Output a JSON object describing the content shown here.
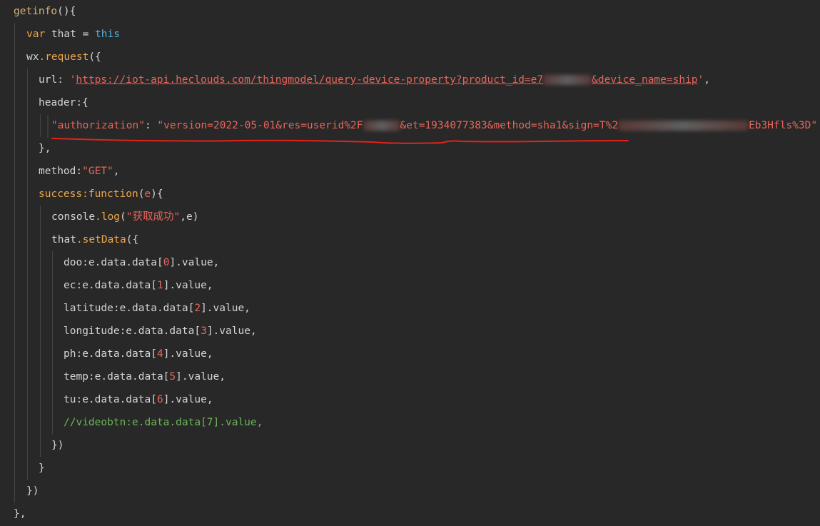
{
  "code": {
    "fn_name": "getinfo",
    "fn_open": "(){",
    "var_kw": "var",
    "that": "that",
    "eq": " = ",
    "this_kw": "this",
    "wx": "wx",
    "request": ".request",
    "request_open": "({",
    "url_key": "url: ",
    "quote": "'",
    "url_part1": "https://iot-api.heclouds.com/thingmodel/query-device-property?product_id=e7",
    "url_part2": "&device_name=ship",
    "url_end": ",",
    "header_key": "header:{",
    "auth_key": "\"authorization\"",
    "colon": ": ",
    "auth_part1": "\"version=2022-05-01&res=userid%2F",
    "auth_part2": "&et=1934077383&method=sha1&sign=T%2",
    "auth_part3": "Eb3Hfls%3D\"",
    "close_brace_comma": "},",
    "method_key": "method:",
    "method_val": "\"GET\"",
    "comma": ",",
    "success_key": "success:",
    "function_kw": "function",
    "success_args_open": "(",
    "success_arg": "e",
    "success_args_close": "){",
    "console": "console",
    "log": ".log",
    "paren_open": "(",
    "log_msg": "\"获取成功\"",
    "log_tail": ",e)",
    "set_data": ".setData",
    "set_data_open": "({",
    "fields": [
      {
        "key": "doo",
        "index": "0"
      },
      {
        "key": "ec",
        "index": "1"
      },
      {
        "key": "latitude",
        "index": "2"
      },
      {
        "key": "longitude",
        "index": "3"
      },
      {
        "key": "ph",
        "index": "4"
      },
      {
        "key": "temp",
        "index": "5"
      },
      {
        "key": "tu",
        "index": "6"
      }
    ],
    "field_mid": ":e.data.data[",
    "field_tail": "].value,",
    "comment_line": "//videobtn:e.data.data[7].value,",
    "close_setdata": "})",
    "close_success": "}",
    "close_request": "})",
    "close_fn": "},"
  },
  "colors": {
    "background": "#282828",
    "keyword": "#f0a64a",
    "string": "#e8655a",
    "comment": "#6cb55a",
    "blue": "#4fb3d9",
    "annotation": "#e0231b"
  }
}
